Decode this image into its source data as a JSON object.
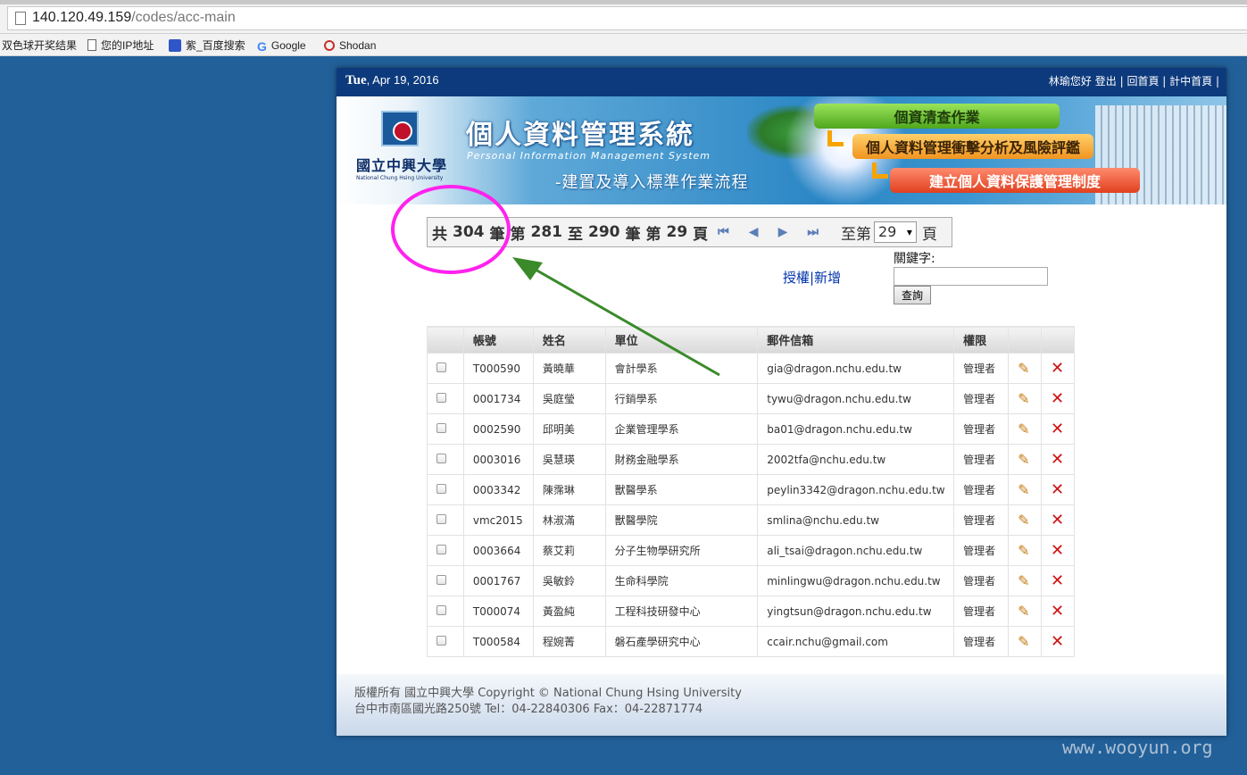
{
  "browser": {
    "url_host": "140.120.49.159",
    "url_path": "/codes/acc-main",
    "bookmarks": [
      {
        "label": "双色球开奖结果",
        "icon": "none"
      },
      {
        "label": "您的IP地址",
        "icon": "document-icon"
      },
      {
        "label": "紫_百度搜索",
        "icon": "baidu-paw-icon"
      },
      {
        "label": "Google",
        "icon": "google-g-icon"
      },
      {
        "label": "Shodan",
        "icon": "shodan-icon"
      }
    ]
  },
  "header": {
    "day": "Tue",
    "date": ", Apr 19, 2016",
    "greeting": "林瑜您好",
    "logout": "登出",
    "home": "回首頁",
    "center_home": "計中首頁"
  },
  "banner": {
    "logo_cn": "國立中興大學",
    "logo_en": "National Chung Hsing University",
    "title_cn": "個人資料管理系統",
    "title_en": "Personal Information Management System",
    "subtitle": "-建置及導入標準作業流程",
    "steps": [
      "個資清查作業",
      "個人資料管理衝擊分析及風險評鑑",
      "建立個人資料保護管理制度"
    ]
  },
  "pager": {
    "total_prefix": "共",
    "total": "304",
    "unit": "筆",
    "range_prefix": "第",
    "from": "281",
    "to_word": "至",
    "to": "290",
    "page_prefix": "第",
    "page": "29",
    "page_unit": "頁",
    "jump_label": "至第",
    "jump_value": "29",
    "jump_unit": "頁"
  },
  "actions": {
    "authorize": "授權",
    "add": "新增",
    "keyword_label": "關鍵字:",
    "search_button": "查詢"
  },
  "table": {
    "headers": [
      "",
      "帳號",
      "姓名",
      "單位",
      "郵件信箱",
      "權限",
      "",
      ""
    ],
    "rows": [
      {
        "account": "T000590",
        "name": "黃曉華",
        "unit": "會計學系",
        "email": "gia@dragon.nchu.edu.tw",
        "role": "管理者"
      },
      {
        "account": "0001734",
        "name": "吳庭瑩",
        "unit": "行銷學系",
        "email": "tywu@dragon.nchu.edu.tw",
        "role": "管理者"
      },
      {
        "account": "0002590",
        "name": "邱明美",
        "unit": "企業管理學系",
        "email": "ba01@dragon.nchu.edu.tw",
        "role": "管理者"
      },
      {
        "account": "0003016",
        "name": "吳慧瑛",
        "unit": "財務金融學系",
        "email": "2002tfa@nchu.edu.tw",
        "role": "管理者"
      },
      {
        "account": "0003342",
        "name": "陳霈琳",
        "unit": "獸醫學系",
        "email": "peylin3342@dragon.nchu.edu.tw",
        "role": "管理者"
      },
      {
        "account": "vmc2015",
        "name": "林淑滿",
        "unit": "獸醫學院",
        "email": "smlina@nchu.edu.tw",
        "role": "管理者"
      },
      {
        "account": "0003664",
        "name": "蔡艾莉",
        "unit": "分子生物學研究所",
        "email": "ali_tsai@dragon.nchu.edu.tw",
        "role": "管理者"
      },
      {
        "account": "0001767",
        "name": "吳敏鈴",
        "unit": "生命科學院",
        "email": "minlingwu@dragon.nchu.edu.tw",
        "role": "管理者"
      },
      {
        "account": "T000074",
        "name": "黃盈純",
        "unit": "工程科技研發中心",
        "email": "yingtsun@dragon.nchu.edu.tw",
        "role": "管理者"
      },
      {
        "account": "T000584",
        "name": "程婉菁",
        "unit": "磐石產學研究中心",
        "email": "ccair.nchu@gmail.com",
        "role": "管理者"
      }
    ]
  },
  "footer": {
    "line1": "版權所有 國立中興大學    Copyright © National Chung Hsing University",
    "line2": "台中市南區國光路250號    Tel：04-22840306    Fax：04-22871774"
  },
  "watermark": "www.wooyun.org",
  "colors": {
    "background": "#22609a",
    "topbar": "#0d3a7c",
    "highlight_circle": "#ff22ee",
    "arrow": "#3a8a2a"
  }
}
